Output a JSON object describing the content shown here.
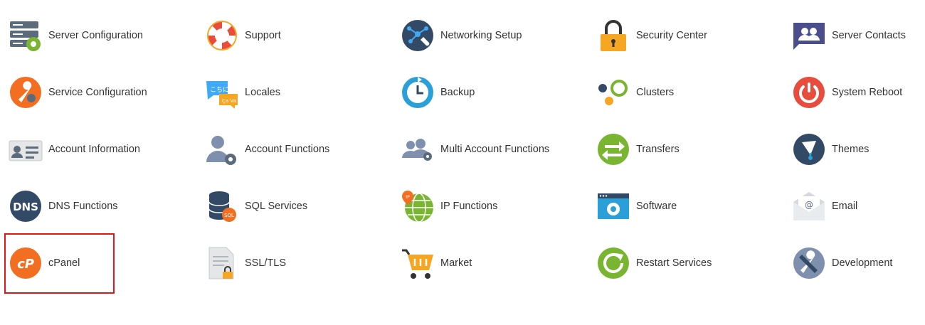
{
  "tiles": [
    {
      "label": "Server Configuration",
      "icon": "server-config-icon"
    },
    {
      "label": "Support",
      "icon": "lifebuoy-icon"
    },
    {
      "label": "Networking Setup",
      "icon": "network-wrench-icon"
    },
    {
      "label": "Security Center",
      "icon": "padlock-icon"
    },
    {
      "label": "Server Contacts",
      "icon": "contacts-chat-icon"
    },
    {
      "label": "Service Configuration",
      "icon": "wrench-gear-icon"
    },
    {
      "label": "Locales",
      "icon": "locale-bubbles-icon"
    },
    {
      "label": "Backup",
      "icon": "backup-clock-icon"
    },
    {
      "label": "Clusters",
      "icon": "clusters-icon"
    },
    {
      "label": "System Reboot",
      "icon": "power-icon"
    },
    {
      "label": "Account Information",
      "icon": "id-card-icon"
    },
    {
      "label": "Account Functions",
      "icon": "user-gear-icon"
    },
    {
      "label": "Multi Account Functions",
      "icon": "users-gear-icon"
    },
    {
      "label": "Transfers",
      "icon": "transfer-arrows-icon"
    },
    {
      "label": "Themes",
      "icon": "paint-brush-icon"
    },
    {
      "label": "DNS Functions",
      "icon": "dns-icon"
    },
    {
      "label": "SQL Services",
      "icon": "database-sql-icon"
    },
    {
      "label": "IP Functions",
      "icon": "globe-ip-icon"
    },
    {
      "label": "Software",
      "icon": "software-window-icon"
    },
    {
      "label": "Email",
      "icon": "envelope-at-icon"
    },
    {
      "label": "cPanel",
      "icon": "cpanel-logo-icon"
    },
    {
      "label": "SSL/TLS",
      "icon": "certificate-lock-icon"
    },
    {
      "label": "Market",
      "icon": "shopping-cart-icon"
    },
    {
      "label": "Restart Services",
      "icon": "restart-icon"
    },
    {
      "label": "Development",
      "icon": "dev-tools-icon"
    }
  ],
  "colors": {
    "label_text": "#333333",
    "highlight_border": "#e0161b",
    "cpanel_orange": "#f26f21",
    "dark_slate": "#334a66"
  }
}
